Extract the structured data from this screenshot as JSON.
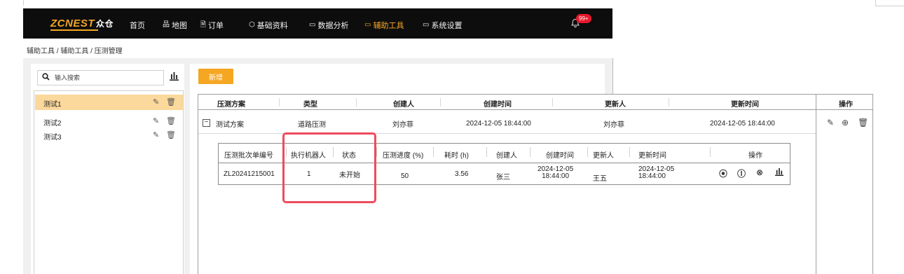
{
  "nav": {
    "logo": "ZCNEST",
    "logo_cn": "众仓",
    "items": [
      {
        "label": "首页",
        "icon": "home-icon",
        "glyph": ""
      },
      {
        "label": "地图",
        "icon": "map-icon",
        "glyph": "品"
      },
      {
        "label": "订单",
        "icon": "order-icon",
        "glyph": "🗎"
      },
      {
        "label": "基础资料",
        "icon": "cube-icon",
        "glyph": "⬡"
      },
      {
        "label": "数据分析",
        "icon": "monitor-icon",
        "glyph": "▭"
      },
      {
        "label": "辅助工具",
        "icon": "monitor-icon",
        "glyph": "▭",
        "active": true
      },
      {
        "label": "系统设置",
        "icon": "monitor-icon",
        "glyph": "▭"
      }
    ],
    "notification_badge": "99+",
    "active_color": "#f5a623"
  },
  "breadcrumb": "辅助工具 / 辅助工具 / 压测管理",
  "sidebar": {
    "search_placeholder": "输入搜索",
    "items": [
      {
        "label": "测试1",
        "selected": true
      },
      {
        "label": "测试2",
        "selected": false
      },
      {
        "label": "测试3",
        "selected": false
      }
    ]
  },
  "toolbar": {
    "new_label": "新增"
  },
  "table": {
    "headers": [
      "压测方案",
      "类型",
      "创建人",
      "创建时间",
      "更新人",
      "更新时间",
      "操作"
    ],
    "rows": [
      {
        "plan": "测试方案",
        "type": "道路压测",
        "creator": "刘亦菲",
        "created": "2024-12-05 18:44:00",
        "updater": "刘亦菲",
        "updated": "2024-12-05 18:44:00"
      }
    ]
  },
  "subtable": {
    "headers": [
      "压测批次单编号",
      "执行机器人",
      "状态",
      "压测进度 (%)",
      "耗时 (h)",
      "创建人",
      "创建时间",
      "更新人",
      "更新时间",
      "操作"
    ],
    "rows": [
      {
        "batch_no": "ZL20241215001",
        "robots": "1",
        "status": "未开始",
        "progress": "50",
        "duration": "3.56",
        "creator": "张三",
        "created_date": "2024-12-05",
        "created_time": "18:44:00",
        "updater": "王五",
        "updated_date": "2024-12-05",
        "updated_time": "18:44:00"
      }
    ]
  },
  "highlight_color": "#ee4b5f"
}
